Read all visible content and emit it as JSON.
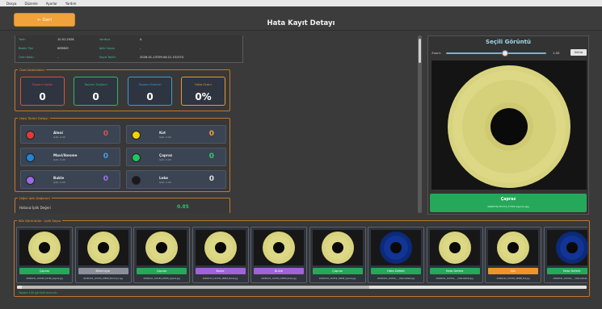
{
  "menu": [
    "Dosya",
    "Düzenle",
    "Ayarlar",
    "Yardım"
  ],
  "header": {
    "back_label": "← Geri",
    "title": "Hata Kayıt Detayı"
  },
  "info": {
    "rows": [
      {
        "label": "Tarih",
        "value": "10.01.2026",
        "label2": "Vardiya",
        "value2": "A"
      },
      {
        "label": "Bobin Tipi",
        "value": "KIRMIZI",
        "label2": "İplik Sayısı",
        "value2": "-"
      },
      {
        "label": "Ürün Kodu",
        "value": "-",
        "label2": "Kayıt Tarihi",
        "value2": "2026-01-13T09:44:21.151574"
      }
    ]
  },
  "summary": {
    "title": "Özet İstatistikler",
    "boxes": [
      {
        "label": "Toplam Hatalı",
        "value": "0",
        "color": "#e0503a"
      },
      {
        "label": "Toplam Sağlam",
        "value": "0",
        "color": "#2fb86a"
      },
      {
        "label": "Toplam Kontrol",
        "value": "0",
        "color": "#3d9ad8"
      },
      {
        "label": "Hata Oranı",
        "value": "0%",
        "color": "#e89a2a"
      }
    ]
  },
  "errors": {
    "title": "Hata Türleri Detayı",
    "items": [
      {
        "name": "Aleni",
        "sub": "İplik: 0.00",
        "count": "0",
        "dot": "#e03a3a",
        "count_color": "#e05050"
      },
      {
        "name": "Kot",
        "sub": "İplik: 0.00",
        "count": "0",
        "dot": "#f2d400",
        "count_color": "#f0a030"
      },
      {
        "name": "Mavi/Ikesme",
        "sub": "İplik: 0.00",
        "count": "0",
        "dot": "#1f86d8",
        "count_color": "#3da0e8"
      },
      {
        "name": "Çapraz",
        "sub": "İplik: 0.00",
        "count": "0",
        "dot": "#22c55e",
        "count_color": "#30c870"
      },
      {
        "name": "Bukle",
        "sub": "İplik: 0.00",
        "count": "0",
        "dot": "#9a6ae8",
        "count_color": "#a070f0"
      },
      {
        "name": "Leke",
        "sub": "İplik: 0.00",
        "count": "0",
        "dot": "#1a1a1a",
        "count_color": "#e0e0e0"
      }
    ]
  },
  "other": {
    "title": "Diğer İplik Değerleri",
    "label": "Hatasız İplik Değeri",
    "value": "0.85"
  },
  "preview": {
    "title": "Seçili Görüntü",
    "zoom_label": "Zoom:",
    "zoom_value": "1.00",
    "reset_label": "Sıfırla",
    "status": "Çapraz",
    "status_sub": "0068730.HY1T2_F7W2 Çapraz.jpg"
  },
  "thumbs": {
    "title": "Kök Görüntüler - İplik Sayısı",
    "items": [
      {
        "status": "Çapraz",
        "color": "#25a85a",
        "file": "20260101_101559_18798_Çapraz.jpg",
        "dark": false
      },
      {
        "status": "Bilinmiyor",
        "color": "#8a8f98",
        "file": "20260101_101559_18808_Bilinmiyor.jpg",
        "dark": false
      },
      {
        "status": "Çapraz",
        "color": "#25a85a",
        "file": "20260101_101559_18818_Çapraz.jpg",
        "dark": false
      },
      {
        "status": "Bukle",
        "color": "#a063d8",
        "file": "20260101_101559_18828_Bukle.jpg",
        "dark": false
      },
      {
        "status": "Bukle",
        "color": "#a063d8",
        "file": "20260101_101559_18838_Bukle.jpg",
        "dark": false
      },
      {
        "status": "Çapraz",
        "color": "#25a85a",
        "file": "20260101_101559_18848_Çapraz.jpg",
        "dark": false
      },
      {
        "status": "Hata Defekt",
        "color": "#25a85a",
        "file": "20260101_101559_..._Hata Defekt.jpg",
        "dark": true
      },
      {
        "status": "Hata Defekt",
        "color": "#25a85a",
        "file": "20260101_101559_..._Hata Defekt.jpg",
        "dark": false
      },
      {
        "status": "Kot",
        "color": "#f0942a",
        "file": "20260101_101559_18888_Kot.jpg",
        "dark": false
      },
      {
        "status": "Hata Defekt",
        "color": "#25a85a",
        "file": "20260101_101559_..._Hata Defekt.jpg",
        "dark": true
      }
    ],
    "footer": "Toplam 100 görüntü bulundu"
  }
}
